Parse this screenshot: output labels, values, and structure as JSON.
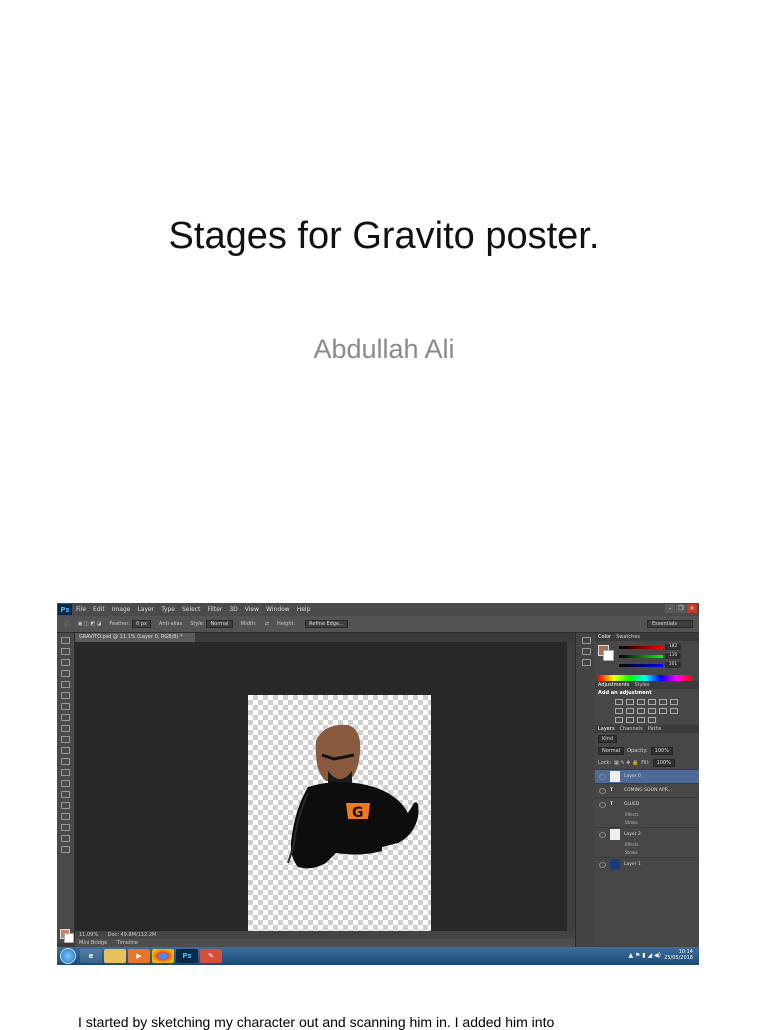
{
  "slide": {
    "title": "Stages for Gravito poster.",
    "author": "Abdullah Ali",
    "caption": "I started by sketching my character out and scanning him in. I added him into"
  },
  "photoshop": {
    "logo": "Ps",
    "menu": [
      "File",
      "Edit",
      "Image",
      "Layer",
      "Type",
      "Select",
      "Filter",
      "3D",
      "View",
      "Window",
      "Help"
    ],
    "options": {
      "feather_label": "Feather:",
      "feather_value": "0 px",
      "anti_alias": "Anti-alias",
      "style_label": "Style:",
      "style_value": "Normal",
      "width_label": "Width:",
      "height_label": "Height:",
      "refine_edge": "Refine Edge...",
      "workspace": "Essentials"
    },
    "document_tab": "GRAVITO.psd @ 11.1% (Layer 0, RGB/8) *",
    "status": {
      "zoom": "11.09%",
      "doc": "Doc: 49.8M/112.2M"
    },
    "bottom_tabs": [
      "Mini Bridge",
      "Timeline"
    ],
    "color_panel": {
      "tabs": [
        "Color",
        "Swatches"
      ],
      "r": "182",
      "g": "116",
      "b": "101"
    },
    "adjustments": {
      "tabs": [
        "Adjustments",
        "Styles"
      ],
      "heading": "Add an adjustment"
    },
    "layers_panel": {
      "tabs": [
        "Layers",
        "Channels",
        "Paths"
      ],
      "kind": "Kind",
      "blend": "Normal",
      "opacity_label": "Opacity:",
      "opacity": "100%",
      "lock_label": "Lock:",
      "fill_label": "Fill:",
      "fill": "100%",
      "effects": "Effects",
      "stroke": "Stroke",
      "layers": [
        {
          "name": "Layer 0",
          "type": "image",
          "selected": true
        },
        {
          "name": "COMING SOON APR...",
          "type": "text"
        },
        {
          "name": "GLUED",
          "type": "text"
        },
        {
          "name": "Layer 2",
          "type": "image"
        },
        {
          "name": "Layer 1",
          "type": "image"
        }
      ]
    },
    "taskbar": {
      "time": "10:14",
      "date": "25/05/2018",
      "apps": [
        "ie-icon",
        "folder-icon",
        "media-icon",
        "chrome-icon",
        "photoshop-icon",
        "paint-icon"
      ],
      "app_labels": [
        "e",
        "",
        "▶",
        "",
        "Ps",
        "✎"
      ]
    },
    "colors": {
      "accent": "#4f6a96",
      "skin": "#8a5a3e",
      "logo_orange": "#f07a1a"
    }
  }
}
